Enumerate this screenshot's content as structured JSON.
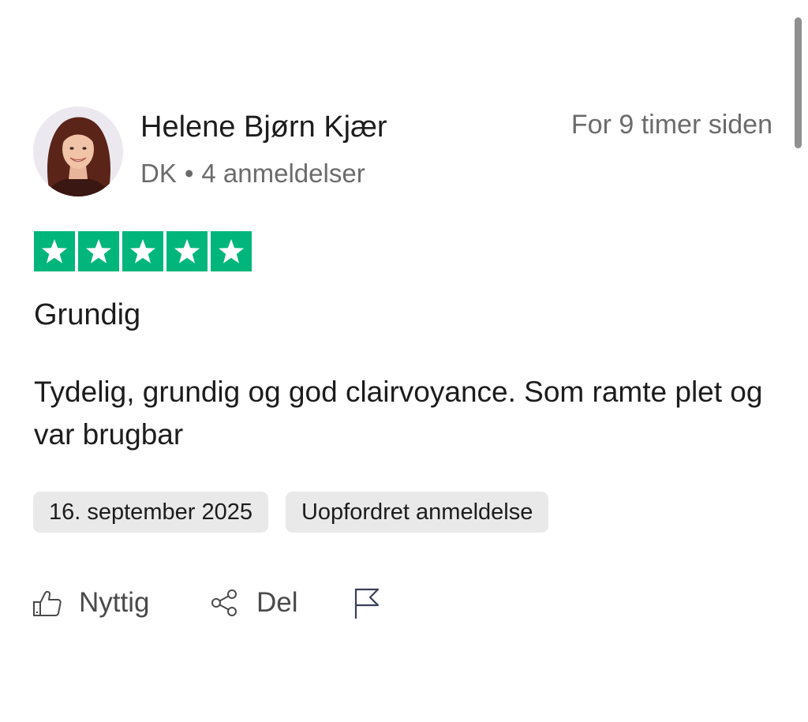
{
  "reviewer": {
    "name": "Helene Bjørn Kjær",
    "country": "DK",
    "separator": "•",
    "review_count": "4 anmeldelser",
    "avatar_icon": "reviewer-photo"
  },
  "review": {
    "posted": "For 9 timer siden",
    "rating": 5,
    "rating_max": 5,
    "star_color": "#00b67a",
    "title": "Grundig",
    "body": "Tydelig, grundig og god clairvoyance. Som ramte plet og var brugbar",
    "date_chip": "16. september 2025",
    "type_chip": "Uopfordret anmeldelse"
  },
  "actions": {
    "useful_label": "Nyttig",
    "useful_icon": "thumbs-up-icon",
    "share_label": "Del",
    "share_icon": "share-icon",
    "report_icon": "flag-icon"
  }
}
